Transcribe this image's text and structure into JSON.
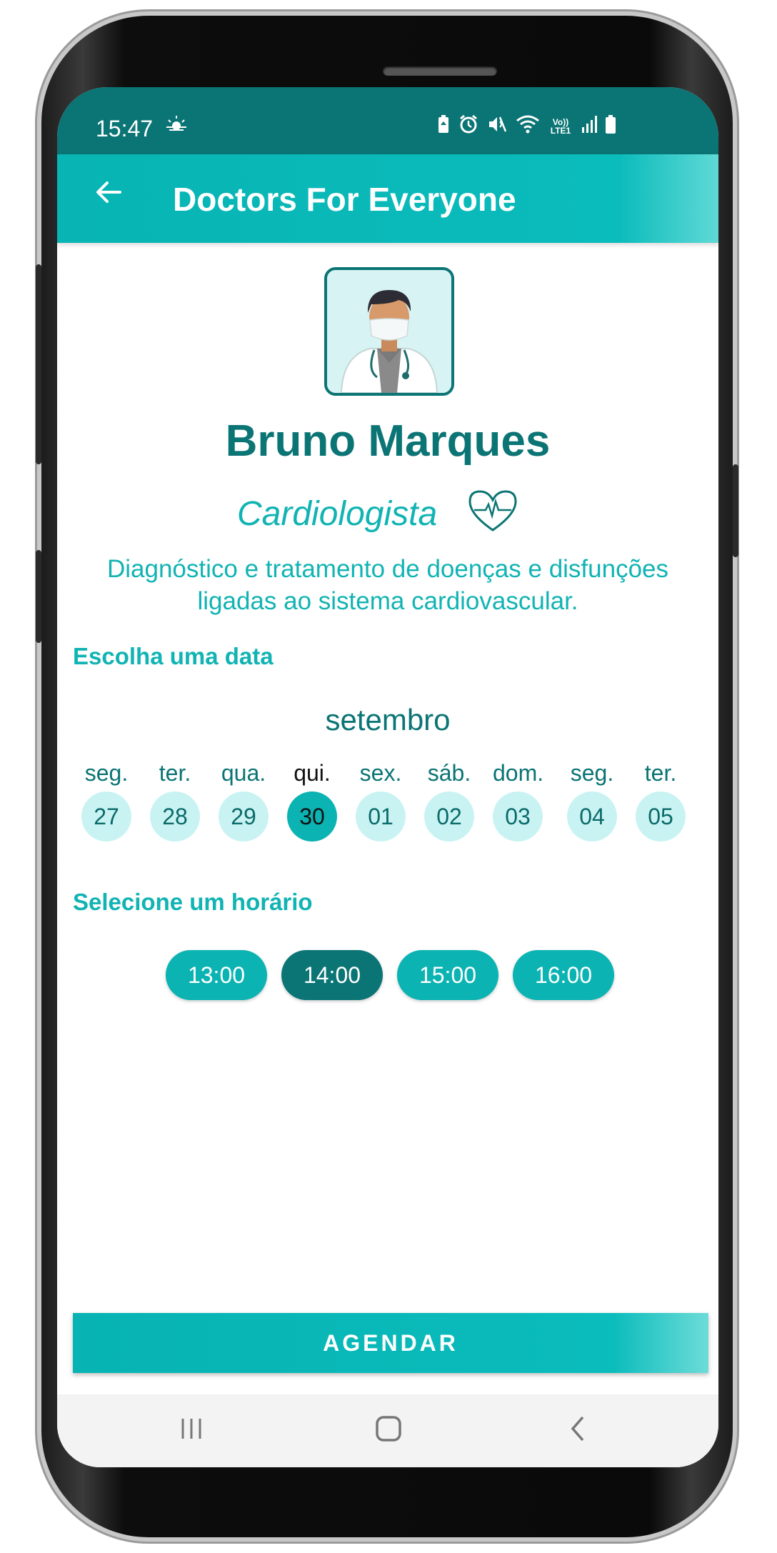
{
  "status_bar": {
    "time": "15:47",
    "weather_icon": "sun-cloud-icon",
    "icons": [
      "battery-saver-icon",
      "alarm-icon",
      "mute-icon",
      "wifi-icon",
      "volte-icon",
      "signal-icon",
      "battery-icon"
    ],
    "volte_label": "Vo)) LTE1"
  },
  "app_bar": {
    "back_icon": "arrow-left-icon",
    "title": "Doctors For Everyone",
    "color": "#0bb3b3"
  },
  "doctor": {
    "avatar_icon": "doctor-avatar-icon",
    "name": "Bruno Marques",
    "specialty": "Cardiologista",
    "specialty_icon": "heart-pulse-icon",
    "description": "Diagnóstico e tratamento de doenças e disfunções ligadas ao sistema cardiovascular."
  },
  "date_section": {
    "title": "Escolha uma data",
    "month": "setembro",
    "days": [
      {
        "weekday": "seg.",
        "date": "27",
        "selected": false
      },
      {
        "weekday": "ter.",
        "date": "28",
        "selected": false
      },
      {
        "weekday": "qua.",
        "date": "29",
        "selected": false
      },
      {
        "weekday": "qui.",
        "date": "30",
        "selected": true
      },
      {
        "weekday": "sex.",
        "date": "01",
        "selected": false
      },
      {
        "weekday": "sáb.",
        "date": "02",
        "selected": false
      },
      {
        "weekday": "dom.",
        "date": "03",
        "selected": false
      },
      {
        "weekday": "seg.",
        "date": "04",
        "selected": false
      },
      {
        "weekday": "ter.",
        "date": "05",
        "selected": false
      }
    ]
  },
  "time_section": {
    "title": "Selecione um horário",
    "slots": [
      {
        "label": "13:00",
        "selected": false
      },
      {
        "label": "14:00",
        "selected": true
      },
      {
        "label": "15:00",
        "selected": false
      },
      {
        "label": "16:00",
        "selected": false
      }
    ]
  },
  "book_button": "AGENDAR",
  "nav_bar": [
    "recent-apps-icon",
    "home-icon",
    "back-icon"
  ],
  "colors": {
    "accent": "#0bb3b3",
    "dark": "#0b7474",
    "light": "#c9f3f3"
  }
}
